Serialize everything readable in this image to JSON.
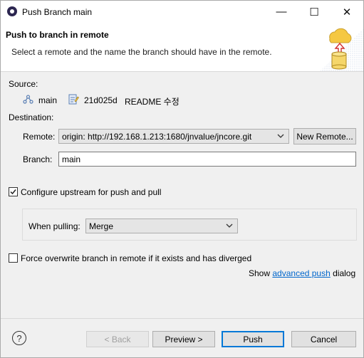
{
  "window": {
    "title": "Push Branch main",
    "minimize_glyph": "—",
    "maximize_glyph": "☐",
    "close_glyph": "✕"
  },
  "banner": {
    "title": "Push to branch in remote",
    "description": "Select a remote and the name the branch should have in the remote."
  },
  "source": {
    "label": "Source:",
    "branch": "main",
    "commit_id": "21d025d",
    "commit_message": "README 수정"
  },
  "destination": {
    "label": "Destination:",
    "remote_label": "Remote:",
    "remote_value": "origin: http://192.168.1.213:1680/jnvalue/jncore.git",
    "new_remote_button": "New Remote...",
    "branch_label": "Branch:",
    "branch_value": "main"
  },
  "upstream": {
    "checkbox_label": "Configure upstream for push and pull",
    "checked": true,
    "when_pulling_label": "When pulling:",
    "when_pulling_value": "Merge"
  },
  "force": {
    "checkbox_label": "Force overwrite branch in remote if it exists and has diverged",
    "checked": false
  },
  "advanced": {
    "prefix": "Show",
    "link": "advanced push",
    "suffix": "dialog"
  },
  "footer": {
    "help_glyph": "?",
    "back_button": "< Back",
    "preview_button": "Preview >",
    "push_button": "Push",
    "cancel_button": "Cancel"
  },
  "colors": {
    "accent": "#0078d7",
    "link": "#0066cc"
  },
  "icons": {
    "app": "eclipse-icon",
    "banner": "cloud-push-icon",
    "branch": "git-branch-icon",
    "commit": "commit-icon"
  }
}
